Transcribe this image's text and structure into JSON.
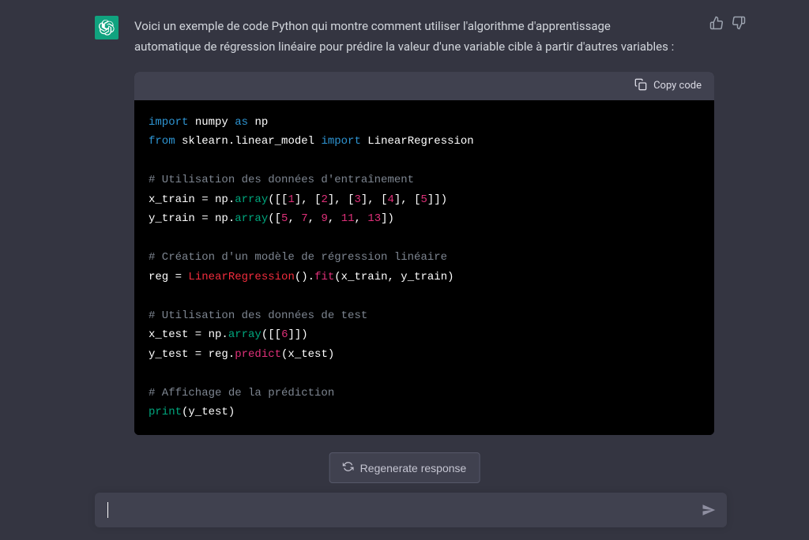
{
  "message": {
    "intro": "Voici un exemple de code Python qui montre comment utiliser l'algorithme d'apprentissage automatique de régression linéaire pour prédire la valeur d'une variable cible à partir d'autres variables :"
  },
  "code": {
    "copy_label": "Copy code",
    "lines": {
      "l1_import": "import",
      "l1_numpy": "numpy",
      "l1_as": "as",
      "l1_np": "np",
      "l2_from": "from",
      "l2_mod": "sklearn.linear_model",
      "l2_import": "import",
      "l2_cls": "LinearRegression",
      "l4_com": "# Utilisation des données d'entraînement",
      "l5_var": "x_train = np.",
      "l5_fn": "array",
      "l5_open": "([[",
      "l5_n1": "1",
      "l5_s1": "], [",
      "l5_n2": "2",
      "l5_s2": "], [",
      "l5_n3": "3",
      "l5_s3": "], [",
      "l5_n4": "4",
      "l5_s4": "], [",
      "l5_n5": "5",
      "l5_close": "]])",
      "l6_var": "y_train = np.",
      "l6_fn": "array",
      "l6_open": "([",
      "l6_n1": "5",
      "l6_c": ", ",
      "l6_n2": "7",
      "l6_n3": "9",
      "l6_n4": "11",
      "l6_n5": "13",
      "l6_close": "])",
      "l8_com": "# Création d'un modèle de régression linéaire",
      "l9_pre": "reg = ",
      "l9_cls": "LinearRegression",
      "l9_mid": "().",
      "l9_fit": "fit",
      "l9_args": "(x_train, y_train)",
      "l11_com": "# Utilisation des données de test",
      "l12_var": "x_test = np.",
      "l12_fn": "array",
      "l12_arg": "([[",
      "l12_n": "6",
      "l12_close": "]])",
      "l13_var": "y_test = reg.",
      "l13_fn": "predict",
      "l13_arg": "(x_test)",
      "l15_com": "# Affichage de la prédiction",
      "l16_fn": "print",
      "l16_arg": "(y_test)"
    }
  },
  "controls": {
    "regenerate": "Regenerate response",
    "input_placeholder": ""
  }
}
